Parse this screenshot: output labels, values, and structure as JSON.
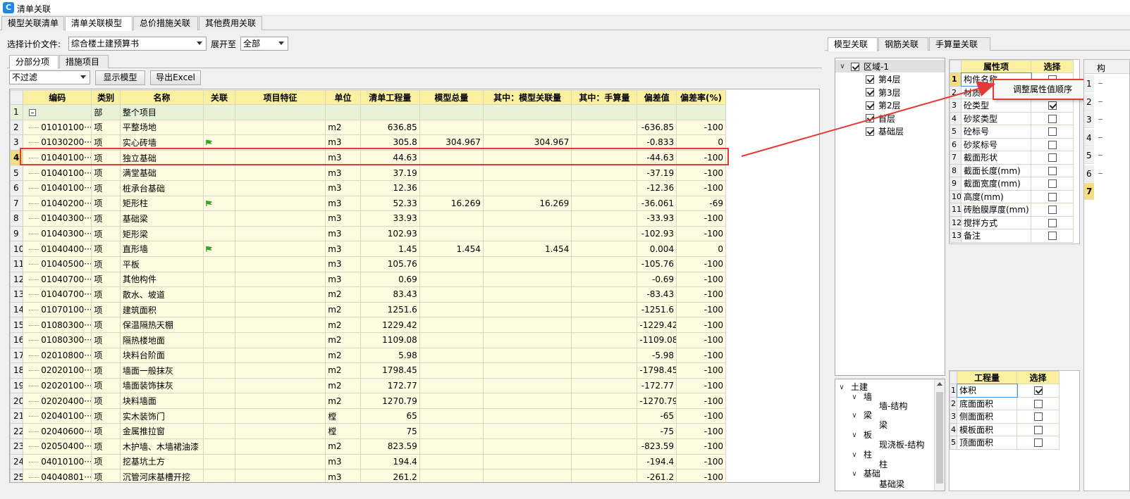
{
  "window": {
    "title": "清单关联"
  },
  "tabs": [
    "模型关联清单",
    "清单关联模型",
    "总价措施关联",
    "其他费用关联"
  ],
  "toolbar": {
    "pricing_label": "选择计价文件:",
    "pricing_value": "综合楼土建预算书",
    "expand_label": "展开至",
    "expand_value": "全部"
  },
  "subtabs": [
    "分部分项",
    "措施项目"
  ],
  "filter": {
    "value": "不过滤",
    "show_model": "显示模型",
    "export": "导出Excel"
  },
  "table": {
    "headers": [
      "编码",
      "类别",
      "名称",
      "关联",
      "项目特征",
      "单位",
      "清单工程量",
      "模型总量",
      "其中：模型关联量",
      "其中：手算量",
      "偏差值",
      "偏差率(%)"
    ],
    "rows": [
      {
        "n": "1",
        "code": "",
        "type": "部",
        "name": "整个项目",
        "link": false,
        "unit": "",
        "qty": "",
        "model": "",
        "mlink": "",
        "manual": "",
        "dev": "",
        "rate": ""
      },
      {
        "n": "2",
        "code": "01010100···",
        "type": "项",
        "name": "平整场地",
        "link": false,
        "unit": "m2",
        "qty": "636.85",
        "model": "",
        "mlink": "",
        "manual": "",
        "dev": "-636.85",
        "rate": "-100"
      },
      {
        "n": "3",
        "code": "01030200···",
        "type": "项",
        "name": "实心砖墙",
        "link": true,
        "unit": "m3",
        "qty": "305.8",
        "model": "304.967",
        "mlink": "304.967",
        "manual": "",
        "dev": "-0.833",
        "rate": "0"
      },
      {
        "n": "4",
        "code": "01040100···",
        "type": "项",
        "name": "独立基础",
        "link": false,
        "unit": "m3",
        "qty": "44.63",
        "model": "",
        "mlink": "",
        "manual": "",
        "dev": "-44.63",
        "rate": "-100"
      },
      {
        "n": "5",
        "code": "01040100···",
        "type": "项",
        "name": "满堂基础",
        "link": false,
        "unit": "m3",
        "qty": "37.19",
        "model": "",
        "mlink": "",
        "manual": "",
        "dev": "-37.19",
        "rate": "-100"
      },
      {
        "n": "6",
        "code": "01040100···",
        "type": "项",
        "name": "桩承台基础",
        "link": false,
        "unit": "m3",
        "qty": "12.36",
        "model": "",
        "mlink": "",
        "manual": "",
        "dev": "-12.36",
        "rate": "-100"
      },
      {
        "n": "7",
        "code": "01040200···",
        "type": "项",
        "name": "矩形柱",
        "link": true,
        "unit": "m3",
        "qty": "52.33",
        "model": "16.269",
        "mlink": "16.269",
        "manual": "",
        "dev": "-36.061",
        "rate": "-69"
      },
      {
        "n": "8",
        "code": "01040300···",
        "type": "项",
        "name": "基础梁",
        "link": false,
        "unit": "m3",
        "qty": "33.93",
        "model": "",
        "mlink": "",
        "manual": "",
        "dev": "-33.93",
        "rate": "-100"
      },
      {
        "n": "9",
        "code": "01040300···",
        "type": "项",
        "name": "矩形梁",
        "link": false,
        "unit": "m3",
        "qty": "102.93",
        "model": "",
        "mlink": "",
        "manual": "",
        "dev": "-102.93",
        "rate": "-100"
      },
      {
        "n": "10",
        "code": "01040400···",
        "type": "项",
        "name": "直形墙",
        "link": true,
        "unit": "m3",
        "qty": "1.45",
        "model": "1.454",
        "mlink": "1.454",
        "manual": "",
        "dev": "0.004",
        "rate": "0"
      },
      {
        "n": "11",
        "code": "01040500···",
        "type": "项",
        "name": "平板",
        "link": false,
        "unit": "m3",
        "qty": "105.76",
        "model": "",
        "mlink": "",
        "manual": "",
        "dev": "-105.76",
        "rate": "-100"
      },
      {
        "n": "12",
        "code": "01040700···",
        "type": "项",
        "name": "其他构件",
        "link": false,
        "unit": "m3",
        "qty": "0.69",
        "model": "",
        "mlink": "",
        "manual": "",
        "dev": "-0.69",
        "rate": "-100"
      },
      {
        "n": "13",
        "code": "01040700···",
        "type": "项",
        "name": "散水、坡道",
        "link": false,
        "unit": "m2",
        "qty": "83.43",
        "model": "",
        "mlink": "",
        "manual": "",
        "dev": "-83.43",
        "rate": "-100"
      },
      {
        "n": "14",
        "code": "01070100···",
        "type": "项",
        "name": "建筑面积",
        "link": false,
        "unit": "m2",
        "qty": "1251.6",
        "model": "",
        "mlink": "",
        "manual": "",
        "dev": "-1251.6",
        "rate": "-100"
      },
      {
        "n": "15",
        "code": "01080300···",
        "type": "项",
        "name": "保温隔热天棚",
        "link": false,
        "unit": "m2",
        "qty": "1229.42",
        "model": "",
        "mlink": "",
        "manual": "",
        "dev": "-1229.42",
        "rate": "-100"
      },
      {
        "n": "16",
        "code": "01080300···",
        "type": "项",
        "name": "隔热楼地面",
        "link": false,
        "unit": "m2",
        "qty": "1109.08",
        "model": "",
        "mlink": "",
        "manual": "",
        "dev": "-1109.08",
        "rate": "-100"
      },
      {
        "n": "17",
        "code": "02010800···",
        "type": "项",
        "name": "块料台阶面",
        "link": false,
        "unit": "m2",
        "qty": "5.98",
        "model": "",
        "mlink": "",
        "manual": "",
        "dev": "-5.98",
        "rate": "-100"
      },
      {
        "n": "18",
        "code": "02020100···",
        "type": "项",
        "name": "墙面一般抹灰",
        "link": false,
        "unit": "m2",
        "qty": "1798.45",
        "model": "",
        "mlink": "",
        "manual": "",
        "dev": "-1798.45",
        "rate": "-100"
      },
      {
        "n": "19",
        "code": "02020100···",
        "type": "项",
        "name": "墙面装饰抹灰",
        "link": false,
        "unit": "m2",
        "qty": "172.77",
        "model": "",
        "mlink": "",
        "manual": "",
        "dev": "-172.77",
        "rate": "-100"
      },
      {
        "n": "20",
        "code": "02020400···",
        "type": "项",
        "name": "块料墙面",
        "link": false,
        "unit": "m2",
        "qty": "1270.79",
        "model": "",
        "mlink": "",
        "manual": "",
        "dev": "-1270.79",
        "rate": "-100"
      },
      {
        "n": "21",
        "code": "02040100···",
        "type": "项",
        "name": "实木装饰门",
        "link": false,
        "unit": "樘",
        "qty": "65",
        "model": "",
        "mlink": "",
        "manual": "",
        "dev": "-65",
        "rate": "-100"
      },
      {
        "n": "22",
        "code": "02040600···",
        "type": "项",
        "name": "金属推拉窗",
        "link": false,
        "unit": "樘",
        "qty": "75",
        "model": "",
        "mlink": "",
        "manual": "",
        "dev": "-75",
        "rate": "-100"
      },
      {
        "n": "23",
        "code": "02050400···",
        "type": "项",
        "name": "木护墙、木墙裙油漆",
        "link": false,
        "unit": "m2",
        "qty": "823.59",
        "model": "",
        "mlink": "",
        "manual": "",
        "dev": "-823.59",
        "rate": "-100"
      },
      {
        "n": "24",
        "code": "04010100···",
        "type": "项",
        "name": "挖基坑土方",
        "link": false,
        "unit": "m3",
        "qty": "194.4",
        "model": "",
        "mlink": "",
        "manual": "",
        "dev": "-194.4",
        "rate": "-100"
      },
      {
        "n": "25",
        "code": "04040801···",
        "type": "项",
        "name": "沉管河床基槽开挖",
        "link": false,
        "unit": "m3",
        "qty": "261.2",
        "model": "",
        "mlink": "",
        "manual": "",
        "dev": "-261.2",
        "rate": "-100"
      }
    ]
  },
  "right_tabs": [
    "模型关联",
    "钢筋关联",
    "手算量关联"
  ],
  "region_tree": {
    "root": "区域-1",
    "floors": [
      "第4层",
      "第3层",
      "第2层",
      "首层",
      "基础层"
    ]
  },
  "attr_table": {
    "headers": [
      "属性项",
      "选择"
    ],
    "rows": [
      {
        "n": "1",
        "name": "构件名称",
        "checked": false
      },
      {
        "n": "2",
        "name": "材质",
        "checked": false
      },
      {
        "n": "3",
        "name": "砼类型",
        "checked": true
      },
      {
        "n": "4",
        "name": "砂浆类型",
        "checked": false
      },
      {
        "n": "5",
        "name": "砼标号",
        "checked": false
      },
      {
        "n": "6",
        "name": "砂浆标号",
        "checked": false
      },
      {
        "n": "7",
        "name": "截面形状",
        "checked": false
      },
      {
        "n": "8",
        "name": "截面长度(mm)",
        "checked": false
      },
      {
        "n": "9",
        "name": "截面宽度(mm)",
        "checked": false
      },
      {
        "n": "10",
        "name": "高度(mm)",
        "checked": false
      },
      {
        "n": "11",
        "name": "砖胎膜厚度(mm)",
        "checked": false
      },
      {
        "n": "12",
        "name": "搅拌方式",
        "checked": false
      },
      {
        "n": "13",
        "name": "备注",
        "checked": false
      }
    ]
  },
  "context_menu": {
    "label": "调整属性值顺序"
  },
  "component_tree": [
    {
      "label": "土建",
      "level": 0,
      "chev": "∨"
    },
    {
      "label": "墙",
      "level": 1,
      "chev": "∨"
    },
    {
      "label": "墙-结构",
      "level": 2,
      "chev": ""
    },
    {
      "label": "梁",
      "level": 1,
      "chev": "∨"
    },
    {
      "label": "梁",
      "level": 2,
      "chev": ""
    },
    {
      "label": "板",
      "level": 1,
      "chev": "∨"
    },
    {
      "label": "现浇板-结构",
      "level": 2,
      "chev": ""
    },
    {
      "label": "柱",
      "level": 1,
      "chev": "∨"
    },
    {
      "label": "柱",
      "level": 2,
      "chev": ""
    },
    {
      "label": "基础",
      "level": 1,
      "chev": "∨"
    },
    {
      "label": "基础梁",
      "level": 2,
      "chev": ""
    }
  ],
  "qty_table": {
    "headers": [
      "工程量",
      "选择"
    ],
    "rows": [
      {
        "n": "1",
        "name": "体积",
        "checked": true
      },
      {
        "n": "2",
        "name": "底面面积",
        "checked": false
      },
      {
        "n": "3",
        "name": "侧面面积",
        "checked": false
      },
      {
        "n": "4",
        "name": "模板面积",
        "checked": false
      },
      {
        "n": "5",
        "name": "顶面面积",
        "checked": false
      }
    ]
  },
  "far_right": {
    "header": "构",
    "rows": [
      "1",
      "2",
      "3",
      "4",
      "5",
      "6",
      "7"
    ]
  },
  "colors": {
    "highlight_border": "#e53935",
    "arrow": "#e53935",
    "header_bg": "#fbf0a0",
    "cell_bg": "#fffbe0"
  }
}
